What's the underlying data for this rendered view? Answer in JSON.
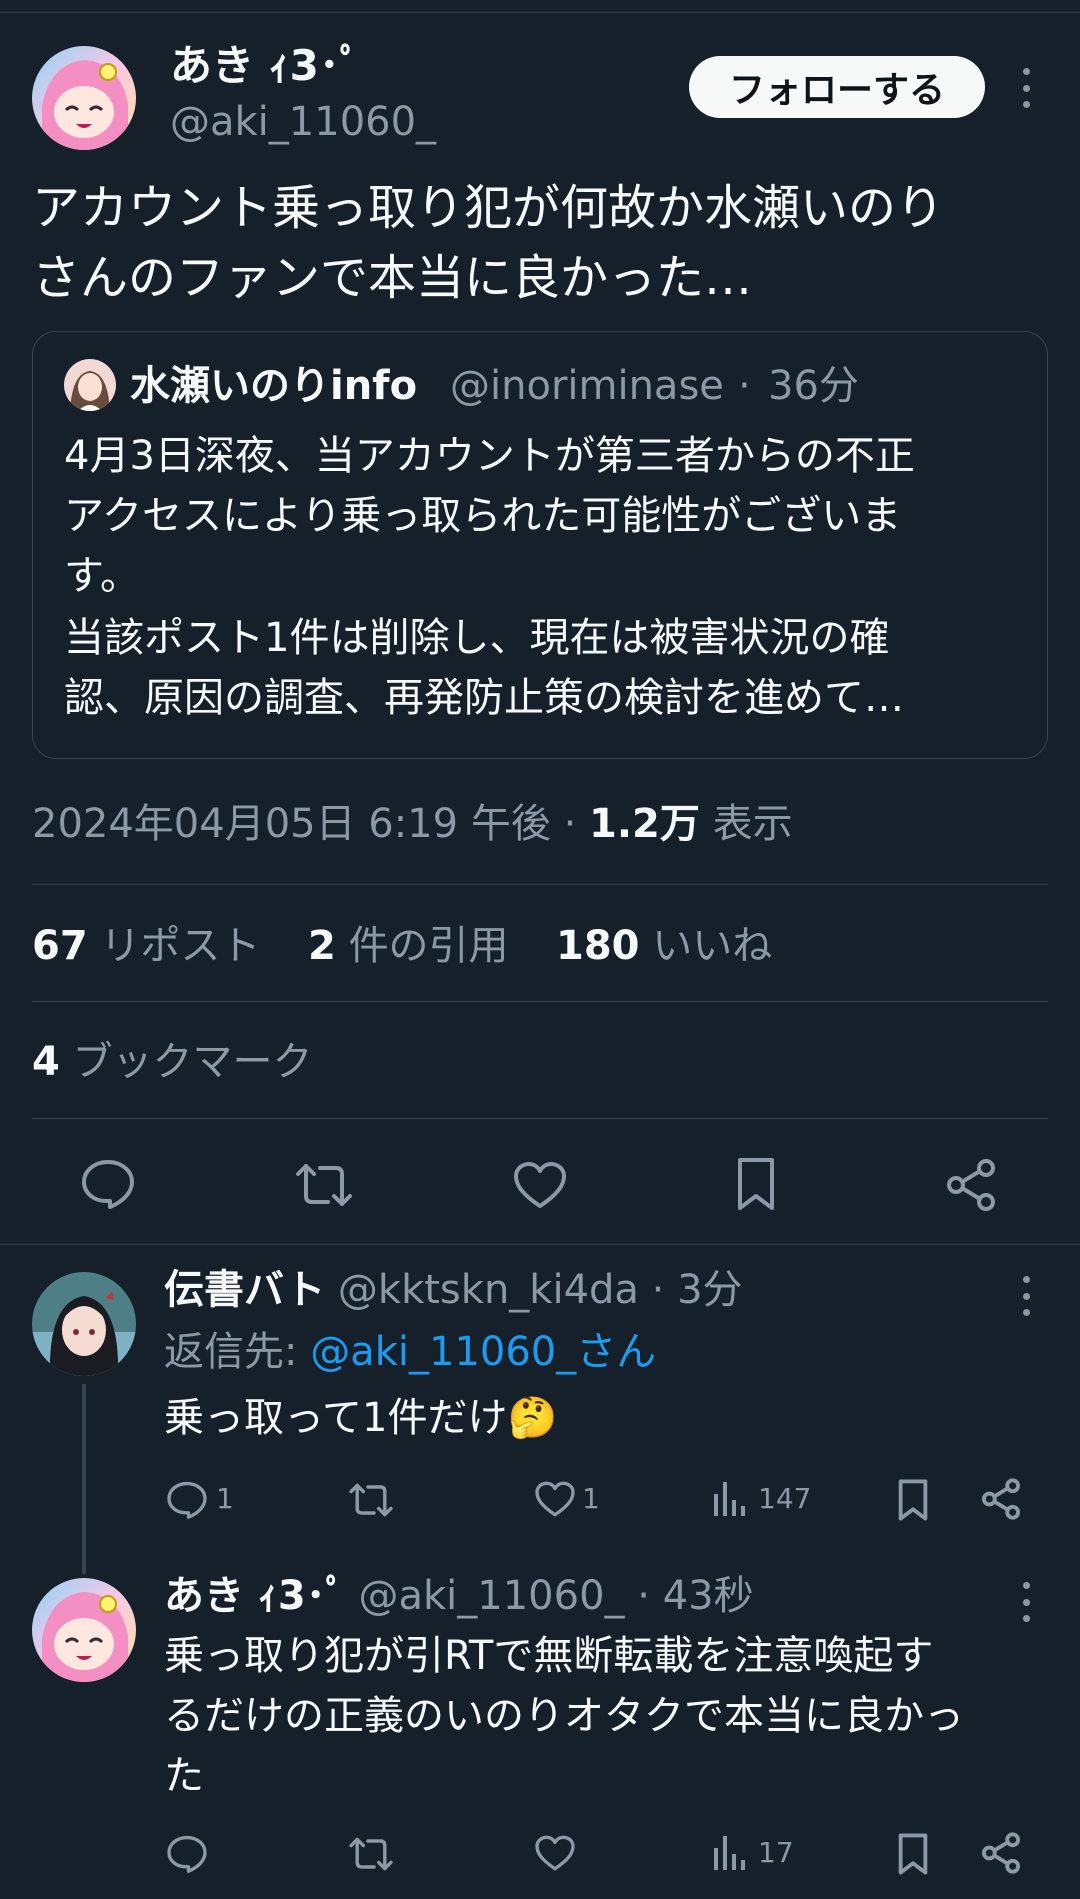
{
  "main_post": {
    "author_name": "あき ｨ3･ﾟ",
    "handle": "@aki_11060_",
    "follow_label": "フォローする",
    "text_line1": "アカウント乗っ取り犯が何故か水瀬いのり",
    "text_line2": "さんのファンで本当に良かった…",
    "timestamp": "2024年04月05日 6:19 午後",
    "views_count": "1.2万",
    "views_label": "表示",
    "stats": {
      "reposts_count": "67",
      "reposts_label": "リポスト",
      "quotes_count": "2",
      "quotes_label": "件の引用",
      "likes_count": "180",
      "likes_label": "いいね",
      "bookmarks_count": "4",
      "bookmarks_label": "ブックマーク"
    }
  },
  "quoted_post": {
    "author_name": "水瀬いのりinfo",
    "handle": "@inoriminase",
    "time": "36分",
    "lines": [
      "4月3日深夜、当アカウントが第三者からの不正",
      "アクセスにより乗っ取られた可能性がございま",
      "す。",
      "当該ポスト1件は削除し、現在は被害状況の確",
      "認、原因の調査、再発防止策の検討を進めて…"
    ]
  },
  "replies": [
    {
      "author_name": "伝書バト",
      "handle": "@kktskn_ki4da",
      "time": "3分",
      "reply_to_prefix": "返信先: ",
      "reply_to_handle": "@aki_11060_さん",
      "text": "乗っ取って1件だけ🤔",
      "reply_count": "1",
      "like_count": "1",
      "view_count": "147"
    },
    {
      "author_name": "あき ｨ3･ﾟ",
      "handle": "@aki_11060_",
      "time": "43秒",
      "lines": [
        "乗っ取り犯が引RTで無断転載を注意喚起す",
        "るだけの正義のいのりオタクで本当に良かっ",
        "た"
      ],
      "view_count": "17"
    }
  ],
  "separator": "·",
  "colors": {
    "background": "#15202b",
    "text": "#f7f9f9",
    "muted": "#8b98a5",
    "border": "#38444d",
    "link": "#1d9bf0"
  }
}
